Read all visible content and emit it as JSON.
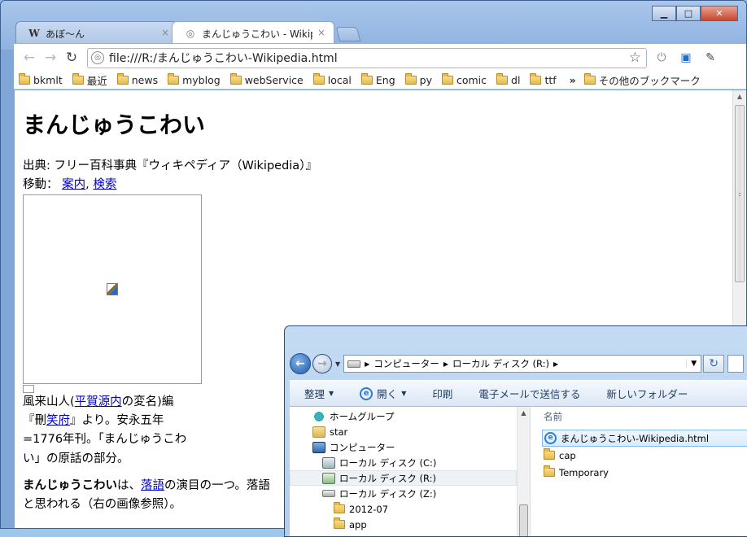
{
  "browser": {
    "tabs": [
      {
        "icon": "W",
        "title": "あぼ〜ん",
        "close": "×"
      },
      {
        "icon": "◎",
        "title": "まんじゅうこわい - Wikipedia",
        "close": "×"
      }
    ],
    "url": "file:///R:/まんじゅうこわい-Wikipedia.html",
    "bookmarks": [
      "bkmlt",
      "最近",
      "news",
      "myblog",
      "webService",
      "local",
      "Eng",
      "py",
      "comic",
      "dl",
      "ttf"
    ],
    "bookmarks_more": "»",
    "other_bookmarks": "その他のブックマーク"
  },
  "page": {
    "title": "まんじゅうこわい",
    "source_line": "出典: フリー百科事典『ウィキペディア（Wikipedia）』",
    "nav_prefix": "移動： ",
    "nav_link1": "案内",
    "nav_sep": ", ",
    "nav_link2": "検索",
    "caption_a": "風来山人(",
    "caption_link1": "平賀源内",
    "caption_b": "の変名)編",
    "caption_c": "『刪",
    "caption_link2": "笑府",
    "caption_d": "』より。安永五年=1776年刊。「まんじゅうこわい」の原話の部分。",
    "para_bold": "まんじゅうこわい",
    "para_a": "は、",
    "para_link": "落語",
    "para_b": "の演目の一つ。落語",
    "para_c": "と思われる（右の画像参照）。"
  },
  "explorer": {
    "breadcrumb": [
      "コンピューター",
      "ローカル ディスク (R:)"
    ],
    "commands": [
      "整理",
      "開く",
      "印刷",
      "電子メールで送信する",
      "新しいフォルダー"
    ],
    "tree": [
      {
        "icon": "grp",
        "label": "ホームグループ",
        "indent": 0
      },
      {
        "icon": "user",
        "label": "star",
        "indent": 0
      },
      {
        "icon": "pc",
        "label": "コンピューター",
        "indent": 0
      },
      {
        "icon": "drvc",
        "label": "ローカル ディスク (C:)",
        "indent": 1
      },
      {
        "icon": "drvr",
        "label": "ローカル ディスク (R:)",
        "indent": 1,
        "selected": true
      },
      {
        "icon": "drvz",
        "label": "ローカル ディスク (Z:)",
        "indent": 1
      },
      {
        "icon": "folder",
        "label": "2012-07",
        "indent": 2
      },
      {
        "icon": "folder",
        "label": "app",
        "indent": 2
      }
    ],
    "column_header": "名前",
    "files": [
      {
        "icon": "ie",
        "name": "まんじゅうこわい-Wikipedia.html",
        "selected": true
      },
      {
        "icon": "folder",
        "name": "cap"
      },
      {
        "icon": "folder",
        "name": "Temporary"
      }
    ]
  }
}
